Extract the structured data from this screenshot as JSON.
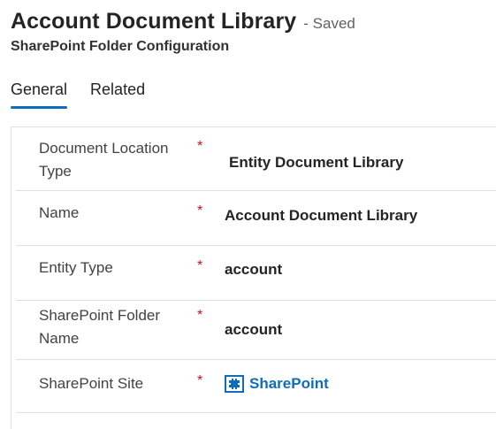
{
  "header": {
    "title": "Account Document Library",
    "status": "- Saved",
    "subtitle": "SharePoint Folder Configuration"
  },
  "tabs": [
    {
      "label": "General",
      "active": true
    },
    {
      "label": "Related",
      "active": false
    }
  ],
  "fields": [
    {
      "label": "Document Location Type",
      "required_mark": "*",
      "value": "Entity Document Library"
    },
    {
      "label": "Name",
      "required_mark": "*",
      "value": "Account Document Library"
    },
    {
      "label": "Entity Type",
      "required_mark": "*",
      "value": "account"
    },
    {
      "label": "SharePoint Folder Name",
      "required_mark": "*",
      "value": "account"
    },
    {
      "label": "SharePoint Site",
      "required_mark": "*",
      "value": "SharePoint",
      "is_link": true,
      "icon": "sharepoint-site-icon"
    }
  ],
  "colors": {
    "accent": "#0f6cbd",
    "required": "#c50f1f",
    "divider": "#e1dfdd"
  }
}
